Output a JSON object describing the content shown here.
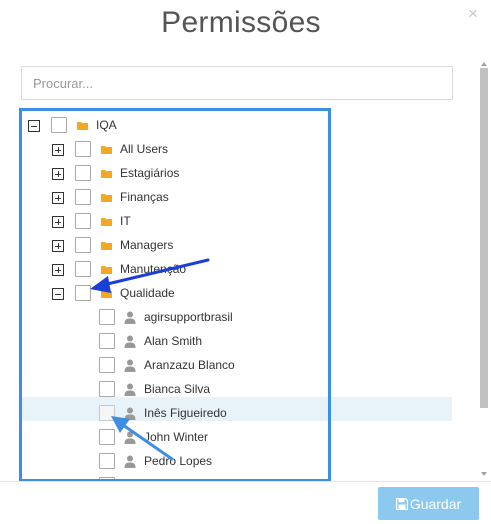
{
  "dialog": {
    "title": "Permissões",
    "close_glyph": "×"
  },
  "search": {
    "placeholder": "Procurar..."
  },
  "tree": {
    "root": {
      "label": "IQA",
      "expanded": true,
      "icon": "folder-icon"
    },
    "groups": [
      {
        "label": "All Users",
        "expanded": false,
        "icon": "folder-icon"
      },
      {
        "label": "Estagiários",
        "expanded": false,
        "icon": "folder-icon"
      },
      {
        "label": "Finanças",
        "expanded": false,
        "icon": "folder-icon"
      },
      {
        "label": "IT",
        "expanded": false,
        "icon": "folder-icon"
      },
      {
        "label": "Managers",
        "expanded": false,
        "icon": "folder-icon"
      },
      {
        "label": "Manutenção",
        "expanded": false,
        "icon": "folder-icon"
      },
      {
        "label": "Qualidade",
        "expanded": true,
        "icon": "folder-icon"
      }
    ],
    "users": [
      {
        "label": "agirsupportbrasil",
        "icon": "user-icon"
      },
      {
        "label": "Alan Smith",
        "icon": "user-icon"
      },
      {
        "label": "Aranzazu Blanco",
        "icon": "user-icon"
      },
      {
        "label": "Bianca Silva",
        "icon": "user-icon"
      },
      {
        "label": "Inês Figueiredo",
        "icon": "user-icon",
        "highlighted": true
      },
      {
        "label": "John Winter",
        "icon": "user-icon"
      },
      {
        "label": "Pedro Lopes",
        "icon": "user-icon"
      }
    ]
  },
  "footer": {
    "save_label": "Guardar",
    "save_icon": "floppy-disk-icon"
  },
  "colors": {
    "folder": "#f5a623",
    "user_icon": "#999999",
    "tree_border": "#3d8fe6",
    "highlight": "#e8f3f9",
    "save_button": "#8cc9ef",
    "arrow_dark": "#1a3fd6",
    "arrow_light": "#3d8fe6"
  }
}
